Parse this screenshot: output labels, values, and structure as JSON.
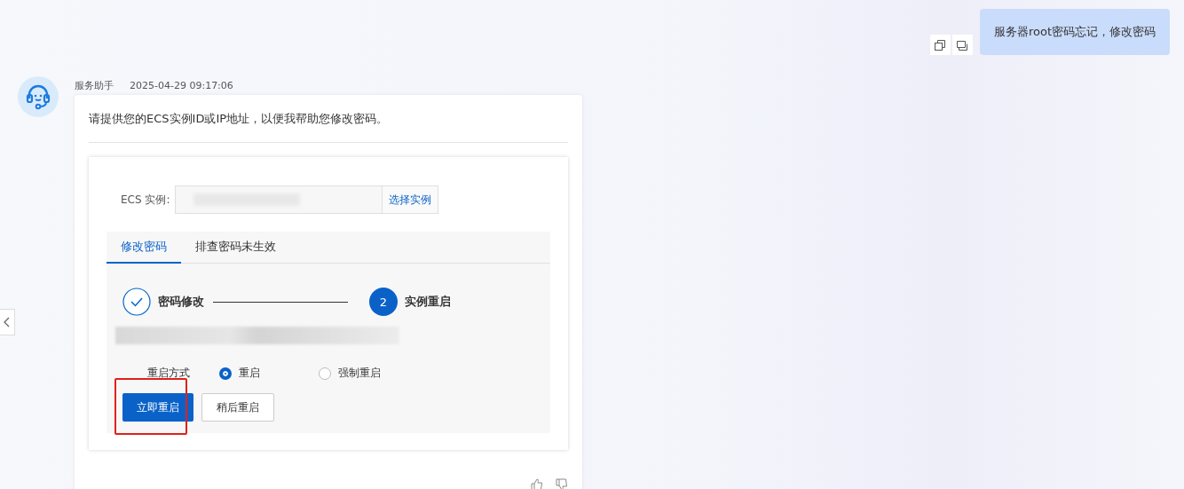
{
  "user_message": {
    "text": "服务器root密码忘记，修改密码"
  },
  "assistant": {
    "name": "服务助手",
    "time": "2025-04-29 09:17:06",
    "text": "请提供您的ECS实例ID或IP地址，以便我帮助您修改密码。",
    "instance_field": {
      "label": "ECS 实例:",
      "button": "选择实例"
    },
    "tabs": [
      {
        "label": "修改密码",
        "selected": true
      },
      {
        "label": "排查密码未生效",
        "selected": false
      }
    ],
    "steps": [
      {
        "label": "密码修改",
        "done": true
      },
      {
        "label": "实例重启",
        "done": false,
        "number": "2"
      }
    ],
    "restart_mode": {
      "label": "重启方式",
      "options": [
        {
          "label": "重启",
          "selected": true
        },
        {
          "label": "强制重启",
          "selected": false
        }
      ]
    },
    "buttons": [
      {
        "label": "立即重启",
        "kind": "primary"
      },
      {
        "label": "稍后重启",
        "kind": "secondary"
      }
    ]
  }
}
